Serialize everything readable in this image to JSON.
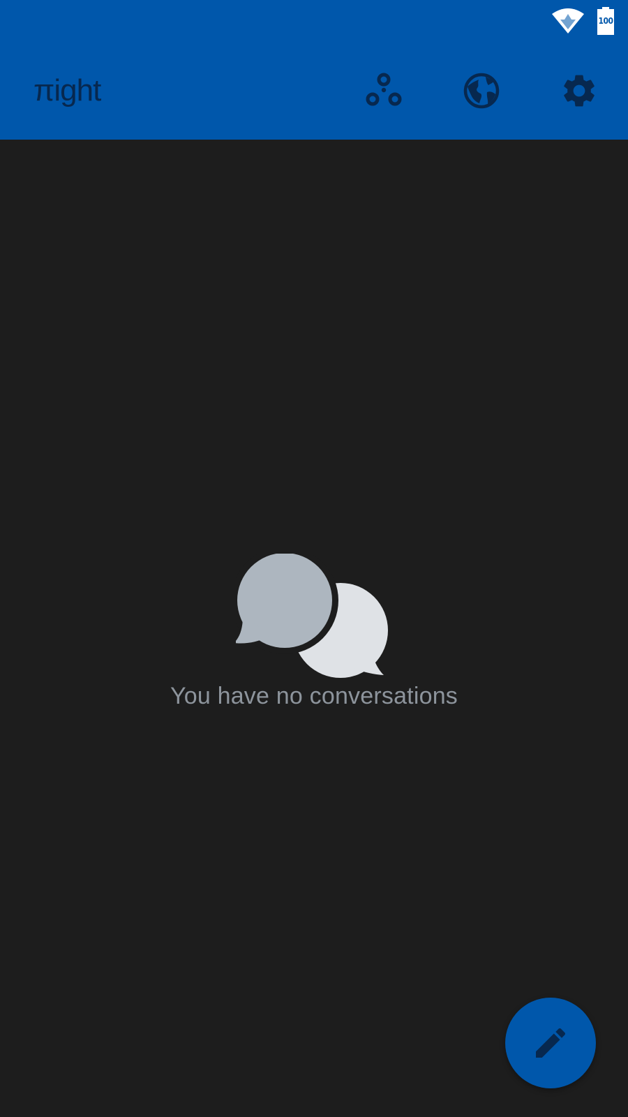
{
  "status_bar": {
    "wifi_icon": "wifi-icon",
    "battery_icon": "battery-icon",
    "battery_level": "100"
  },
  "app_bar": {
    "title": "πight",
    "actions": [
      {
        "name": "contacts",
        "icon": "group-icon"
      },
      {
        "name": "network",
        "icon": "globe-icon"
      },
      {
        "name": "settings",
        "icon": "gear-icon"
      }
    ]
  },
  "main": {
    "empty_icon": "chat-bubbles-icon",
    "empty_message": "You have no conversations"
  },
  "fab": {
    "icon": "pencil-icon",
    "action": "new-conversation"
  },
  "colors": {
    "primary": "#0057ab",
    "background": "#1d1d1d",
    "icon_dark": "#07284f",
    "empty_text": "#8d949c",
    "bubble_back": "#adb6bf",
    "bubble_front": "#dfe2e6"
  }
}
